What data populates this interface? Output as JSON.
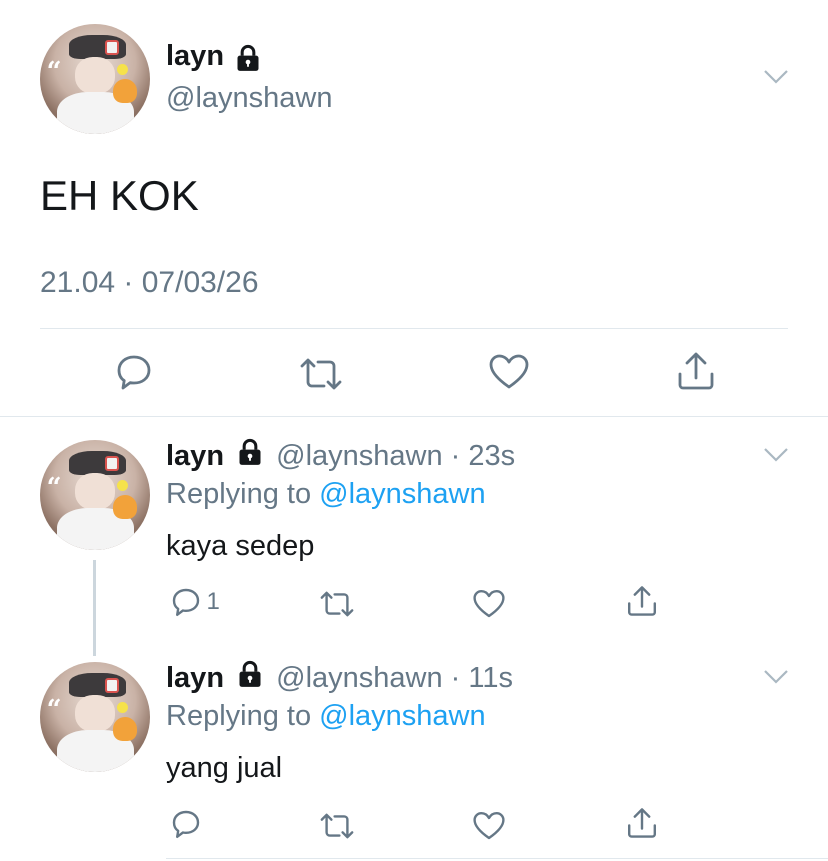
{
  "main_tweet": {
    "display_name": "layn",
    "handle": "@laynshawn",
    "text": "EH KOK",
    "timestamp": "21.04 · 07/03/26"
  },
  "replies": [
    {
      "display_name": "layn",
      "handle": "@laynshawn",
      "time": "23s",
      "replying_prefix": "Replying to",
      "replying_to": "@laynshawn",
      "text": "kaya sedep",
      "reply_count": "1"
    },
    {
      "display_name": "layn",
      "handle": "@laynshawn",
      "time": "11s",
      "replying_prefix": "Replying to",
      "replying_to": "@laynshawn",
      "text": "yang jual",
      "reply_count": ""
    }
  ],
  "icons": {
    "reply": "comment-bubble-icon",
    "retweet": "retweet-icon",
    "like": "heart-icon",
    "share": "share-icon",
    "lock": "lock-icon",
    "more": "chevron-down-icon"
  },
  "colors": {
    "text": "#14171a",
    "secondary": "#657786",
    "link": "#1da1f2",
    "divider": "#e1e8ed"
  }
}
